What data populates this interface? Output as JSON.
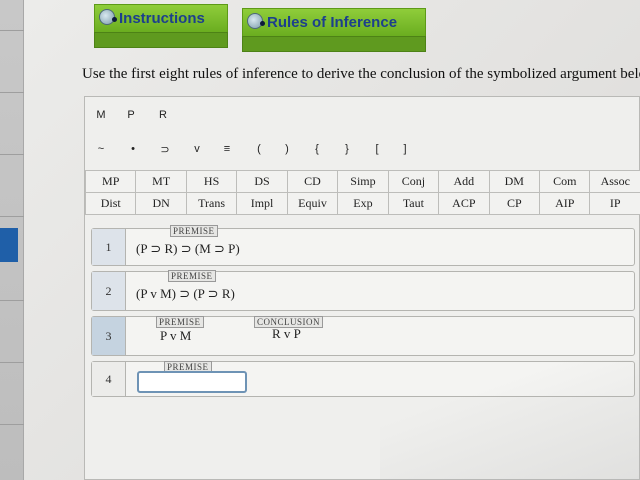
{
  "tabs": [
    {
      "label": "Instructions"
    },
    {
      "label": "Rules of Inference"
    }
  ],
  "instruction": "Use the first eight rules of inference to derive the conclusion of the symbolized argument below.",
  "variables": [
    "M",
    "P",
    "R"
  ],
  "operators": [
    "~",
    "•",
    "⊃",
    "v",
    "≡",
    "(",
    ")",
    "{",
    "}",
    "[",
    "]"
  ],
  "rules_row1": [
    "MP",
    "MT",
    "HS",
    "DS",
    "CD",
    "Simp",
    "Conj",
    "Add",
    "DM",
    "Com",
    "Assoc"
  ],
  "rules_row2": [
    "Dist",
    "DN",
    "Trans",
    "Impl",
    "Equiv",
    "Exp",
    "Taut",
    "ACP",
    "CP",
    "AIP",
    "IP"
  ],
  "lines": [
    {
      "num": "1",
      "tag": "PREMISE",
      "expr": "(P ⊃ R) ⊃ (M ⊃ P)"
    },
    {
      "num": "2",
      "tag": "PREMISE",
      "expr": "(P v M) ⊃ (P ⊃ R)"
    },
    {
      "num": "3",
      "tag": "PREMISE",
      "expr": "P v M",
      "conclusion_tag": "CONCLUSION",
      "conclusion": "R v P"
    },
    {
      "num": "4",
      "tag": "PREMISE",
      "expr": ""
    }
  ]
}
